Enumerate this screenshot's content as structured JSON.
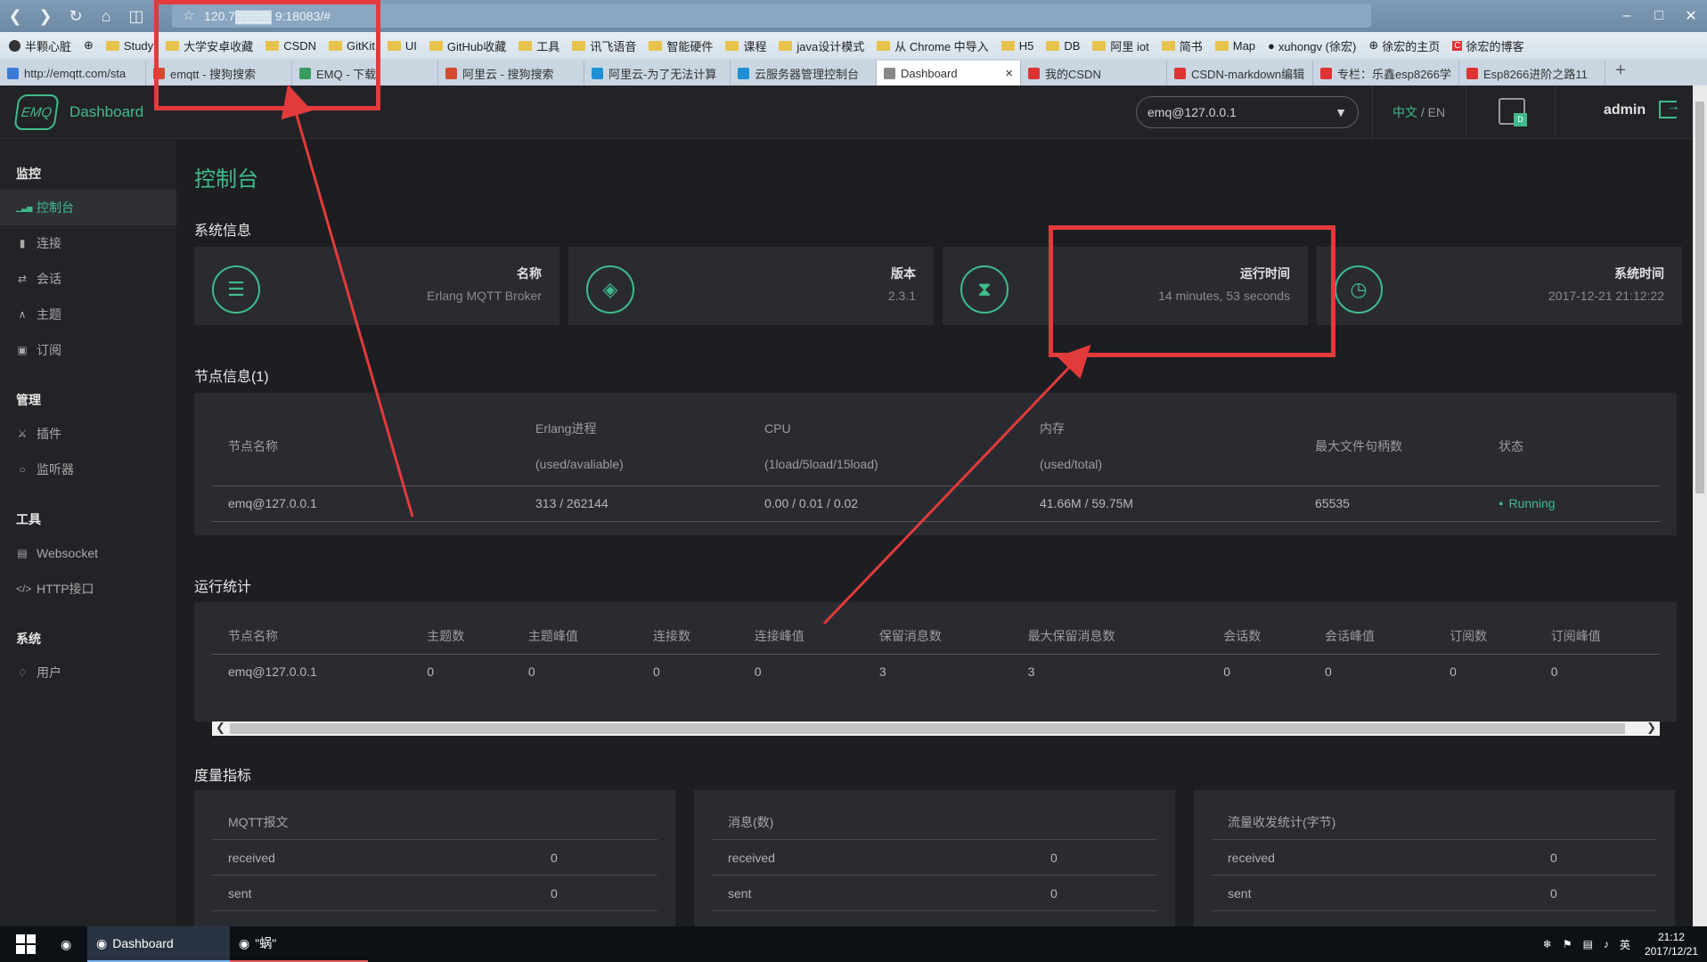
{
  "browser": {
    "address": "120.7▓▓▓▓ 9:18083/#",
    "bookmarks": [
      "半颗心脏",
      "",
      "Study",
      "大学安卓收藏",
      "CSDN",
      "GitKit",
      "UI",
      "GitHub收藏",
      "工具",
      "讯飞语音",
      "智能硬件",
      "课程",
      "java设计模式",
      "从 Chrome 中导入",
      "H5",
      "DB",
      "阿里 iot",
      "简书",
      "Map",
      "xuhongv (徐宏)",
      "徐宏的主页",
      "徐宏的博客"
    ],
    "tabs": [
      "http://emqtt.com/sta",
      "emqtt - 搜狗搜索",
      "EMQ - 下载",
      "阿里云 - 搜狗搜索",
      "阿里云-为了无法计算",
      "云服务器管理控制台",
      "Dashboard",
      "我的CSDN",
      "CSDN-markdown编辑",
      "专栏：乐鑫esp8266学",
      "Esp8266进阶之路11"
    ],
    "active_tab_index": 6
  },
  "header": {
    "logo_text": "EMQ",
    "title": "Dashboard",
    "node_select": "emq@127.0.0.1",
    "lang_zh": "中文",
    "lang_sep": " / ",
    "lang_en": "EN",
    "user": "admin"
  },
  "sidebar": {
    "groups": [
      {
        "title": "监控",
        "items": [
          {
            "label": "控制台",
            "icon": "chart-icon",
            "active": true
          },
          {
            "label": "连接",
            "icon": "connection-icon"
          },
          {
            "label": "会话",
            "icon": "session-icon"
          },
          {
            "label": "主题",
            "icon": "topic-icon"
          },
          {
            "label": "订阅",
            "icon": "subscription-icon"
          }
        ]
      },
      {
        "title": "管理",
        "items": [
          {
            "label": "插件",
            "icon": "plugin-icon"
          },
          {
            "label": "监听器",
            "icon": "listener-icon"
          }
        ]
      },
      {
        "title": "工具",
        "items": [
          {
            "label": "Websocket",
            "icon": "websocket-icon"
          },
          {
            "label": "HTTP接口",
            "icon": "code-icon"
          }
        ]
      },
      {
        "title": "系统",
        "items": [
          {
            "label": "用户",
            "icon": "user-icon"
          }
        ]
      }
    ]
  },
  "page": {
    "title": "控制台",
    "system_info_title": "系统信息",
    "cards": [
      {
        "label": "名称",
        "value": "Erlang MQTT Broker",
        "icon": "document-icon"
      },
      {
        "label": "版本",
        "value": "2.3.1",
        "icon": "layers-icon"
      },
      {
        "label": "运行时间",
        "value": "14 minutes, 53 seconds",
        "icon": "hourglass-icon"
      },
      {
        "label": "系统时间",
        "value": "2017-12-21 21:12:22",
        "icon": "clock-icon"
      }
    ],
    "node_info_title": "节点信息(1)",
    "node_table": {
      "headers": [
        {
          "main": "节点名称",
          "sub": ""
        },
        {
          "main": "Erlang进程",
          "sub": "(used/avaliable)"
        },
        {
          "main": "CPU",
          "sub": "(1load/5load/15load)"
        },
        {
          "main": "内存",
          "sub": "(used/total)"
        },
        {
          "main": "最大文件句柄数",
          "sub": ""
        },
        {
          "main": "状态",
          "sub": ""
        }
      ],
      "row": [
        "emq@127.0.0.1",
        "313 / 262144",
        "0.00 / 0.01 / 0.02",
        "41.66M / 59.75M",
        "65535",
        "Running"
      ]
    },
    "stats_title": "运行统计",
    "stats_table": {
      "headers": [
        "节点名称",
        "主题数",
        "主题峰值",
        "连接数",
        "连接峰值",
        "保留消息数",
        "最大保留消息数",
        "会话数",
        "会话峰值",
        "订阅数",
        "订阅峰值"
      ],
      "row": [
        "emq@127.0.0.1",
        "0",
        "0",
        "0",
        "0",
        "3",
        "3",
        "0",
        "0",
        "0",
        "0"
      ]
    },
    "metrics_title": "度量指标",
    "metrics": [
      {
        "title": "MQTT报文",
        "rows": [
          {
            "k": "received",
            "v": "0"
          },
          {
            "k": "sent",
            "v": "0"
          }
        ]
      },
      {
        "title": "消息(数)",
        "rows": [
          {
            "k": "received",
            "v": "0"
          },
          {
            "k": "sent",
            "v": "0"
          }
        ]
      },
      {
        "title": "流量收发统计(字节)",
        "rows": [
          {
            "k": "received",
            "v": "0"
          },
          {
            "k": "sent",
            "v": "0"
          }
        ]
      }
    ]
  },
  "taskbar": {
    "apps": [
      "Dashboard",
      "\"蜗\""
    ],
    "ime": "英",
    "time": "21:12",
    "date": "2017/12/21"
  },
  "colors": {
    "accent": "#3fbc8c",
    "annotation": "#e33b3b",
    "bg": "#1d1e22",
    "panel": "#2a2b30"
  }
}
